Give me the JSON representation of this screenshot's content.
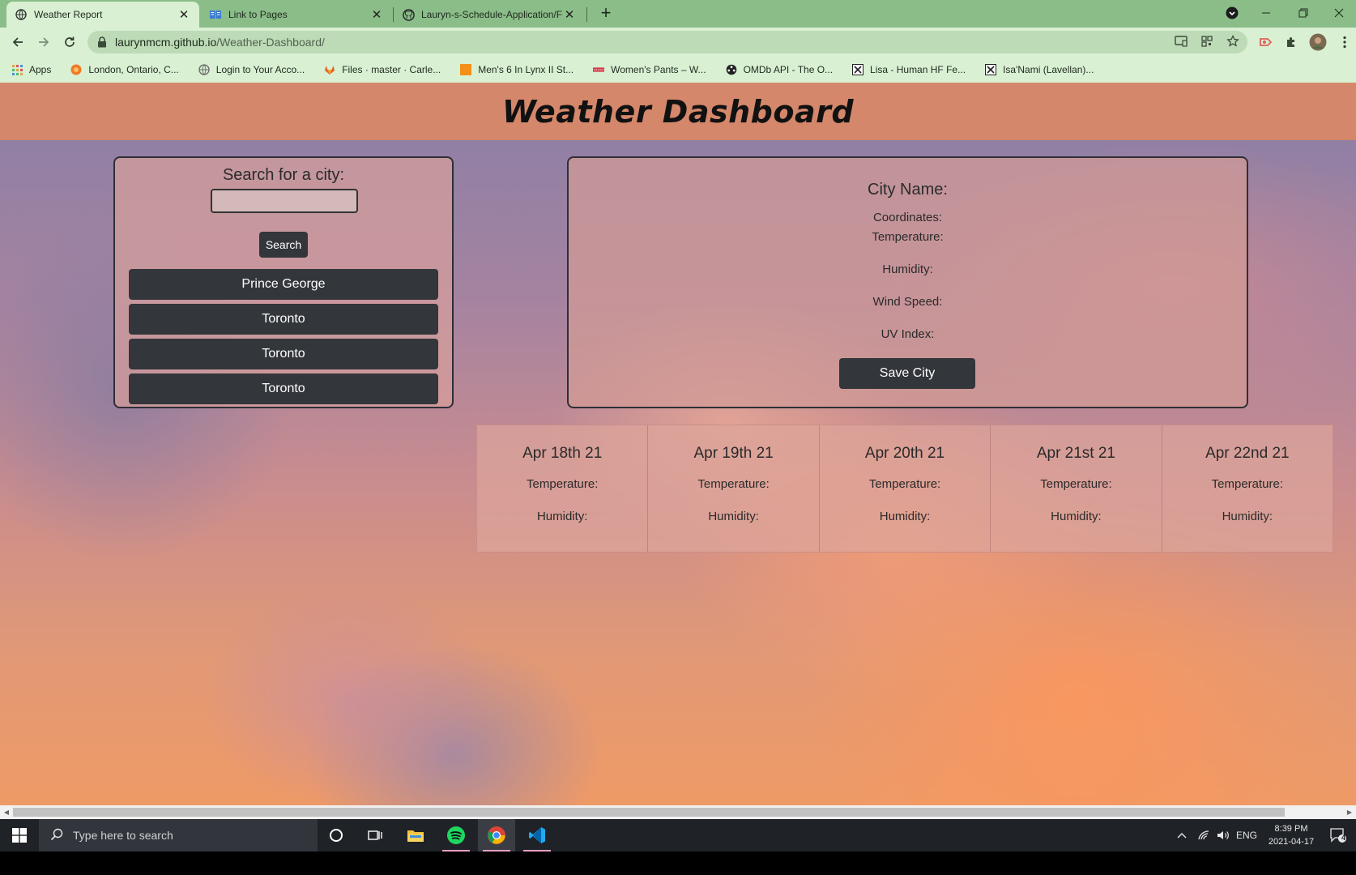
{
  "browser": {
    "tabs": [
      {
        "title": "Weather Report",
        "icon": "globe-icon",
        "active": true
      },
      {
        "title": "Link to Pages",
        "icon": "book-icon",
        "active": false
      },
      {
        "title": "Lauryn-s-Schedule-Application/F",
        "icon": "github-icon",
        "active": false
      }
    ],
    "url_host": "laurynmcm.github.io",
    "url_path": "/Weather-Dashboard/",
    "bookmarks": [
      {
        "label": "Apps",
        "icon": "apps-grid-icon"
      },
      {
        "label": "London, Ontario, C...",
        "icon": "weather-icon"
      },
      {
        "label": "Login to Your Acco...",
        "icon": "globe-icon"
      },
      {
        "label": "Files · master · Carle...",
        "icon": "gitlab-icon"
      },
      {
        "label": "Men's 6 In Lynx II St...",
        "icon": "orange-square-icon"
      },
      {
        "label": "Women's Pants – W...",
        "icon": "flag-icon"
      },
      {
        "label": "OMDb API - The O...",
        "icon": "omdb-icon"
      },
      {
        "label": "Lisa - Human HF Fe...",
        "icon": "hf-icon"
      },
      {
        "label": "Isa'Nami (Lavellan)...",
        "icon": "hf-icon"
      }
    ],
    "theme_color": "#8bbd88"
  },
  "page": {
    "title": "Weather Dashboard",
    "header_color": "#d4876a",
    "search": {
      "heading": "Search for a city:",
      "input_value": "",
      "input_placeholder": "",
      "button_label": "Search",
      "saved_cities": [
        "Prince George",
        "Toronto",
        "Toronto",
        "Toronto"
      ]
    },
    "current": {
      "city_label": "City Name:",
      "coordinates_label": "Coordinates:",
      "temperature_label": "Temperature:",
      "humidity_label": "Humidity:",
      "wind_label": "Wind Speed:",
      "uv_label": "UV Index:",
      "save_button": "Save City"
    },
    "forecast": [
      {
        "date": "Apr 18th 21",
        "temperature_label": "Temperature:",
        "humidity_label": "Humidity:"
      },
      {
        "date": "Apr 19th 21",
        "temperature_label": "Temperature:",
        "humidity_label": "Humidity:"
      },
      {
        "date": "Apr 20th 21",
        "temperature_label": "Temperature:",
        "humidity_label": "Humidity:"
      },
      {
        "date": "Apr 21st 21",
        "temperature_label": "Temperature:",
        "humidity_label": "Humidity:"
      },
      {
        "date": "Apr 22nd 21",
        "temperature_label": "Temperature:",
        "humidity_label": "Humidity:"
      }
    ],
    "button_color": "#33363b"
  },
  "taskbar": {
    "search_placeholder": "Type here to search",
    "language": "ENG",
    "time": "8:39 PM",
    "date": "2021-04-17",
    "notification_count": "4"
  }
}
